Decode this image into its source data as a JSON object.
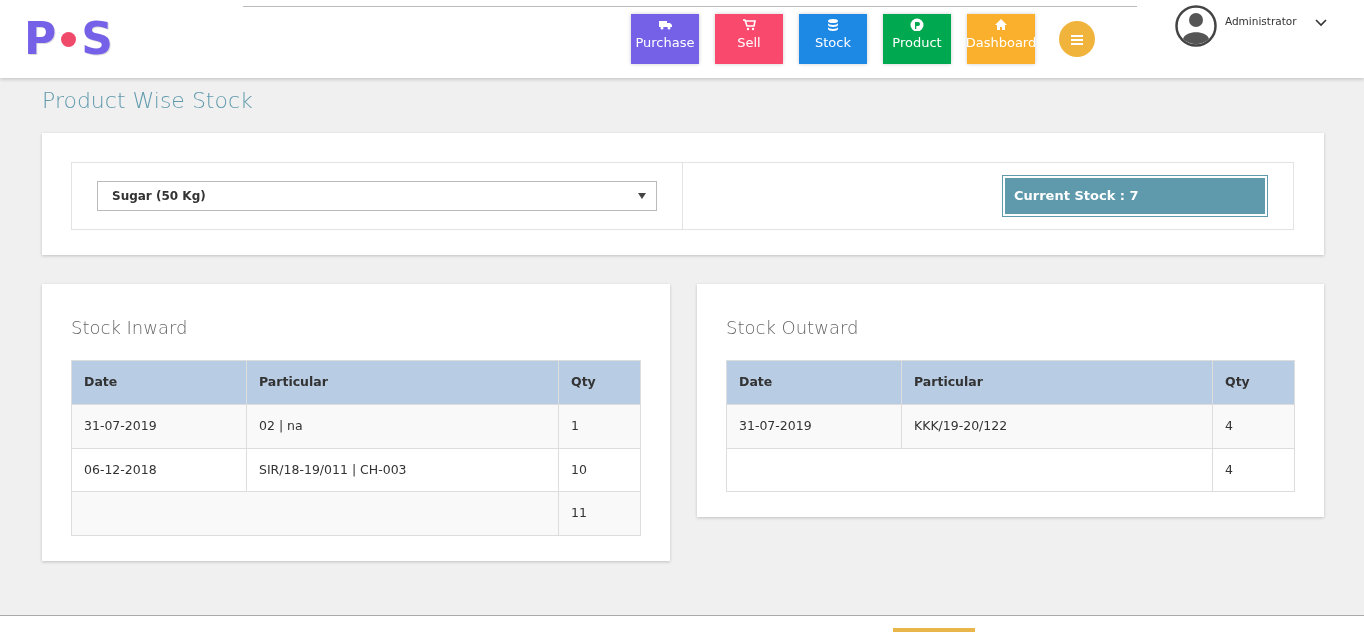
{
  "logo": {
    "letters": [
      "P",
      "S"
    ]
  },
  "nav": [
    {
      "label": "Purchase"
    },
    {
      "label": "Sell"
    },
    {
      "label": "Stock"
    },
    {
      "label": "Product"
    },
    {
      "label": "Dashboard"
    }
  ],
  "user": {
    "name": "Administrator"
  },
  "page_title": "Product Wise Stock",
  "product_select": {
    "value": "Sugar (50 Kg)"
  },
  "current_stock": "Current Stock : 7",
  "panels": [
    {
      "title": "Stock Inward",
      "columns": [
        "Date",
        "Particular",
        "Qty"
      ],
      "rows": [
        [
          "31-07-2019",
          "02 | na",
          "1"
        ],
        [
          "06-12-2018",
          "SIR/18-19/011 | CH-003",
          "10"
        ]
      ],
      "total": "11"
    },
    {
      "title": "Stock Outward",
      "columns": [
        "Date",
        "Particular",
        "Qty"
      ],
      "rows": [
        [
          "31-07-2019",
          "KKK/19-20/122",
          "4"
        ]
      ],
      "total": "4"
    }
  ]
}
